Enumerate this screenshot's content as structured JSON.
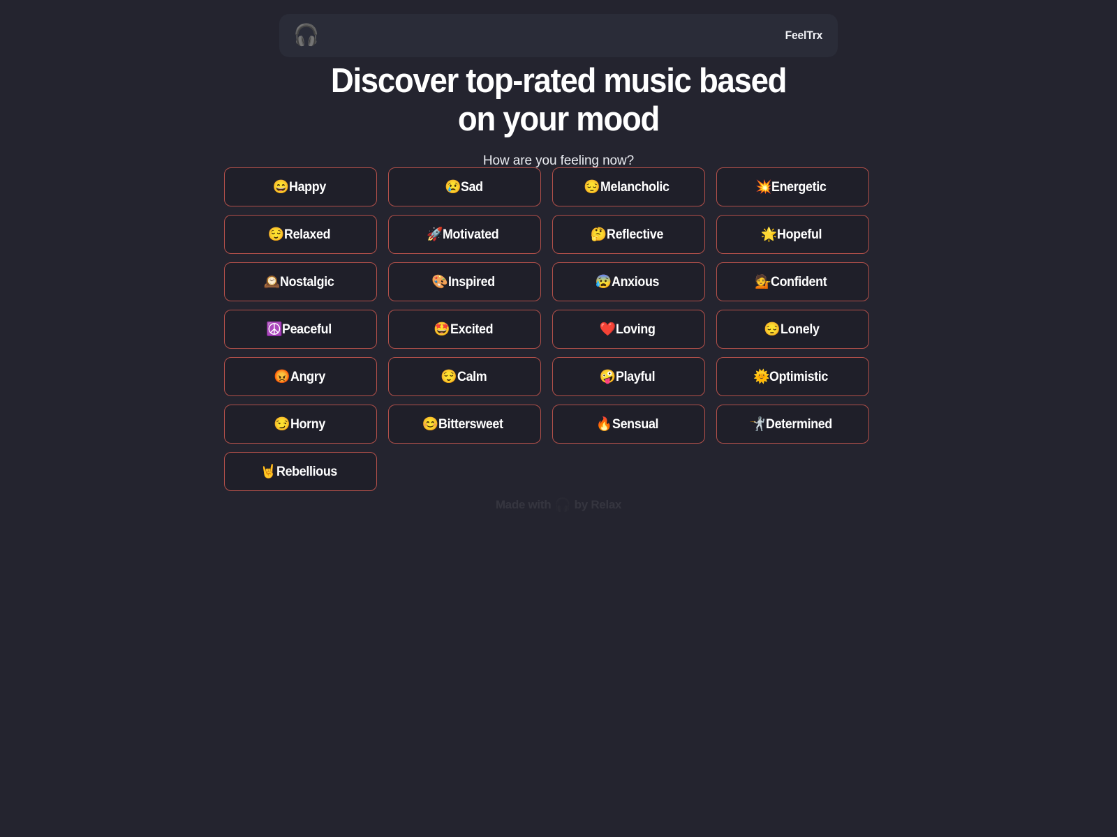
{
  "header": {
    "logo_icon": "headphones-icon",
    "logo_glyph": "🎧",
    "brand_name": "FeelTrx"
  },
  "hero": {
    "title_line1": "Discover top-rated music based",
    "title_line2": "on your mood",
    "subtitle": "How are you feeling now?"
  },
  "moods": [
    {
      "emoji": "😄",
      "label": "Happy",
      "icon": "grinning-smiling-eyes-icon"
    },
    {
      "emoji": "😢",
      "label": "Sad",
      "icon": "crying-face-icon"
    },
    {
      "emoji": "😔",
      "label": "Melancholic",
      "icon": "pensive-face-icon"
    },
    {
      "emoji": "💥",
      "label": "Energetic",
      "icon": "collision-icon"
    },
    {
      "emoji": "😌",
      "label": "Relaxed",
      "icon": "relieved-face-icon"
    },
    {
      "emoji": "🚀",
      "label": "Motivated",
      "icon": "rocket-icon"
    },
    {
      "emoji": "🤔",
      "label": "Reflective",
      "icon": "thinking-face-icon"
    },
    {
      "emoji": "🌟",
      "label": "Hopeful",
      "icon": "glowing-star-icon"
    },
    {
      "emoji": "🕰️",
      "label": "Nostalgic",
      "icon": "mantelpiece-clock-icon"
    },
    {
      "emoji": "🎨",
      "label": "Inspired",
      "icon": "artist-palette-icon"
    },
    {
      "emoji": "😰",
      "label": "Anxious",
      "icon": "anxious-face-sweat-icon"
    },
    {
      "emoji": "💁",
      "label": "Confident",
      "icon": "person-tipping-hand-icon"
    },
    {
      "emoji": "☮️",
      "label": "Peaceful",
      "icon": "peace-symbol-icon"
    },
    {
      "emoji": "🤩",
      "label": "Excited",
      "icon": "star-struck-icon"
    },
    {
      "emoji": "❤️",
      "label": "Loving",
      "icon": "red-heart-icon"
    },
    {
      "emoji": "😔",
      "label": "Lonely",
      "icon": "pensive-face-icon"
    },
    {
      "emoji": "😡",
      "label": "Angry",
      "icon": "enraged-face-icon"
    },
    {
      "emoji": "😌",
      "label": "Calm",
      "icon": "relieved-face-icon"
    },
    {
      "emoji": "🤪",
      "label": "Playful",
      "icon": "zany-face-icon"
    },
    {
      "emoji": "🌞",
      "label": "Optimistic",
      "icon": "sun-with-face-icon"
    },
    {
      "emoji": "😏",
      "label": "Horny",
      "icon": "smirking-face-icon"
    },
    {
      "emoji": "😊",
      "label": "Bittersweet",
      "icon": "smiling-face-smiling-eyes-icon"
    },
    {
      "emoji": "🔥",
      "label": "Sensual",
      "icon": "fire-icon"
    },
    {
      "emoji": "🤺",
      "label": "Determined",
      "icon": "fencer-icon"
    },
    {
      "emoji": "🤘",
      "label": "Rebellious",
      "icon": "sign-of-the-horns-icon"
    }
  ],
  "footer": {
    "prefix": "Made with",
    "emoji": "🎧",
    "suffix": "by Relax"
  },
  "colors": {
    "background": "#24242f",
    "header_bar": "#2a2c38",
    "button_fill": "#1f1f29",
    "button_border": "#b3504a",
    "text_primary": "#ffffff"
  }
}
